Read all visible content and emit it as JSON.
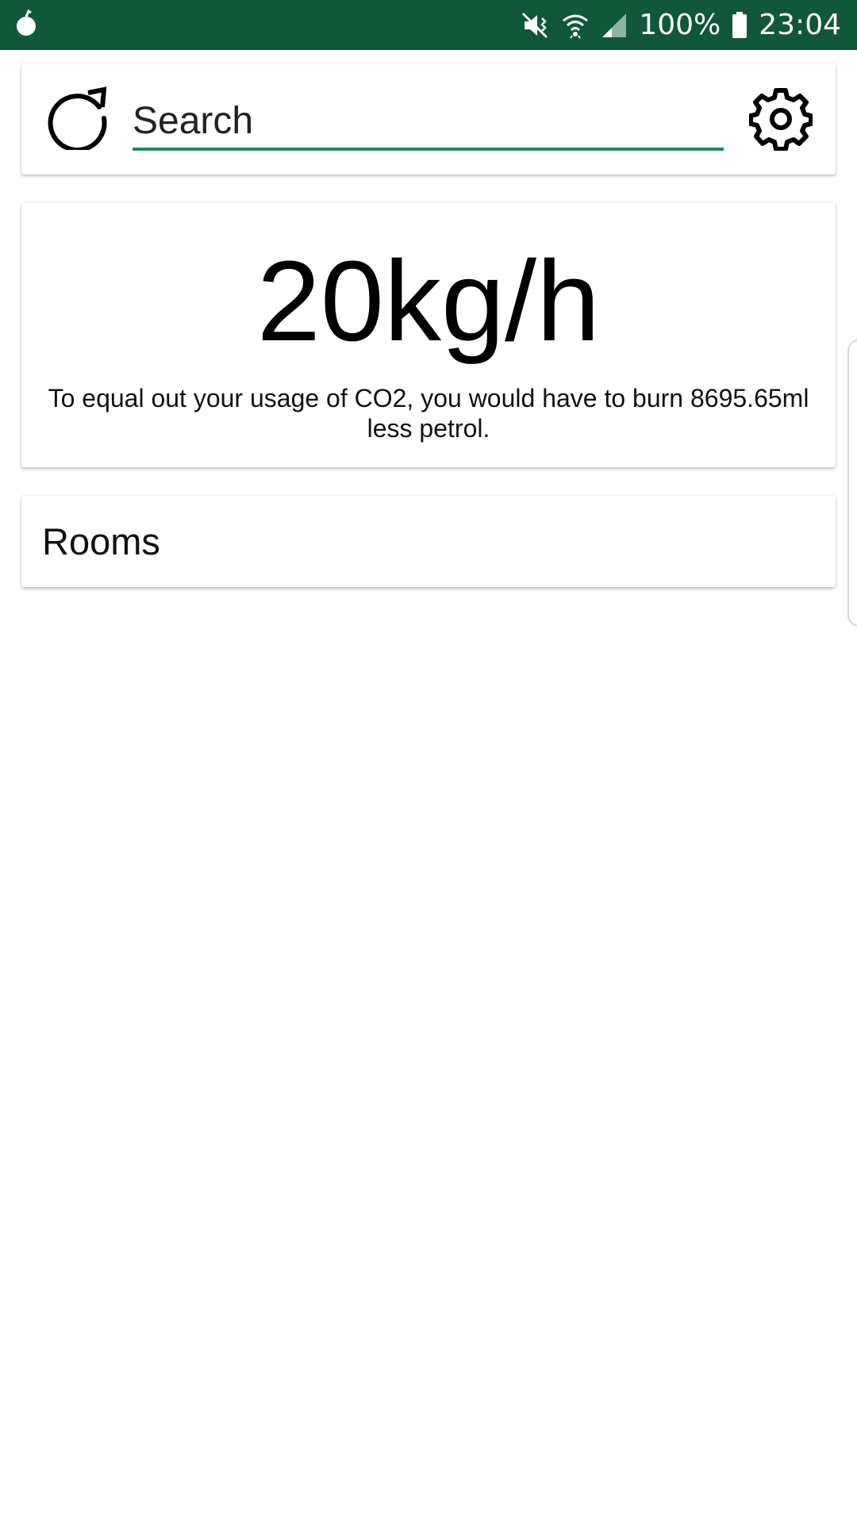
{
  "status_bar": {
    "background": "#11573a",
    "battery_percent": "100%",
    "time": "23:04",
    "icons": [
      "notification-icon",
      "mute-icon",
      "wifi-icon",
      "signal-icon",
      "battery-icon"
    ]
  },
  "search": {
    "placeholder": "Search",
    "value": "",
    "underline_color": "#1e8c53",
    "refresh_icon": "refresh-icon",
    "settings_icon": "gear-icon"
  },
  "stat": {
    "value": "20kg/h",
    "description": "To equal out your usage of CO2, you would have to burn 8695.65ml less petrol."
  },
  "rooms": {
    "title": "Rooms"
  }
}
